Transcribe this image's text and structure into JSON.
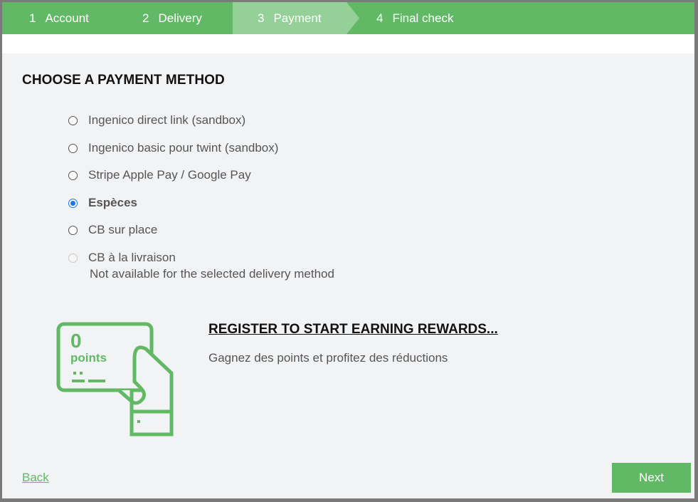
{
  "steps": [
    {
      "num": "1",
      "label": "Account",
      "active": false
    },
    {
      "num": "2",
      "label": "Delivery",
      "active": false
    },
    {
      "num": "3",
      "label": "Payment",
      "active": true
    },
    {
      "num": "4",
      "label": "Final check",
      "active": false
    }
  ],
  "page_title": "CHOOSE A PAYMENT METHOD",
  "payment_methods": [
    {
      "label": "Ingenico direct link (sandbox)",
      "state": "unchecked"
    },
    {
      "label": "Ingenico basic pour twint (sandbox)",
      "state": "unchecked"
    },
    {
      "label": "Stripe Apple Pay / Google Pay",
      "state": "unchecked"
    },
    {
      "label": "Espèces",
      "state": "checked"
    },
    {
      "label": "CB sur place",
      "state": "unchecked"
    },
    {
      "label": "CB à la livraison",
      "state": "disabled",
      "note": "Not available for the selected delivery method"
    }
  ],
  "rewards": {
    "card_points_value": "0",
    "card_points_label": "points",
    "title": "REGISTER TO START EARNING REWARDS...",
    "subtitle": "Gagnez des points et profitez des réductions"
  },
  "nav": {
    "back_label": "Back",
    "next_label": "Next"
  },
  "colors": {
    "brand_green": "#62b965",
    "active_step_green": "#94d097",
    "radio_selected": "#1a73e8",
    "content_bg": "#f2f3f5"
  }
}
